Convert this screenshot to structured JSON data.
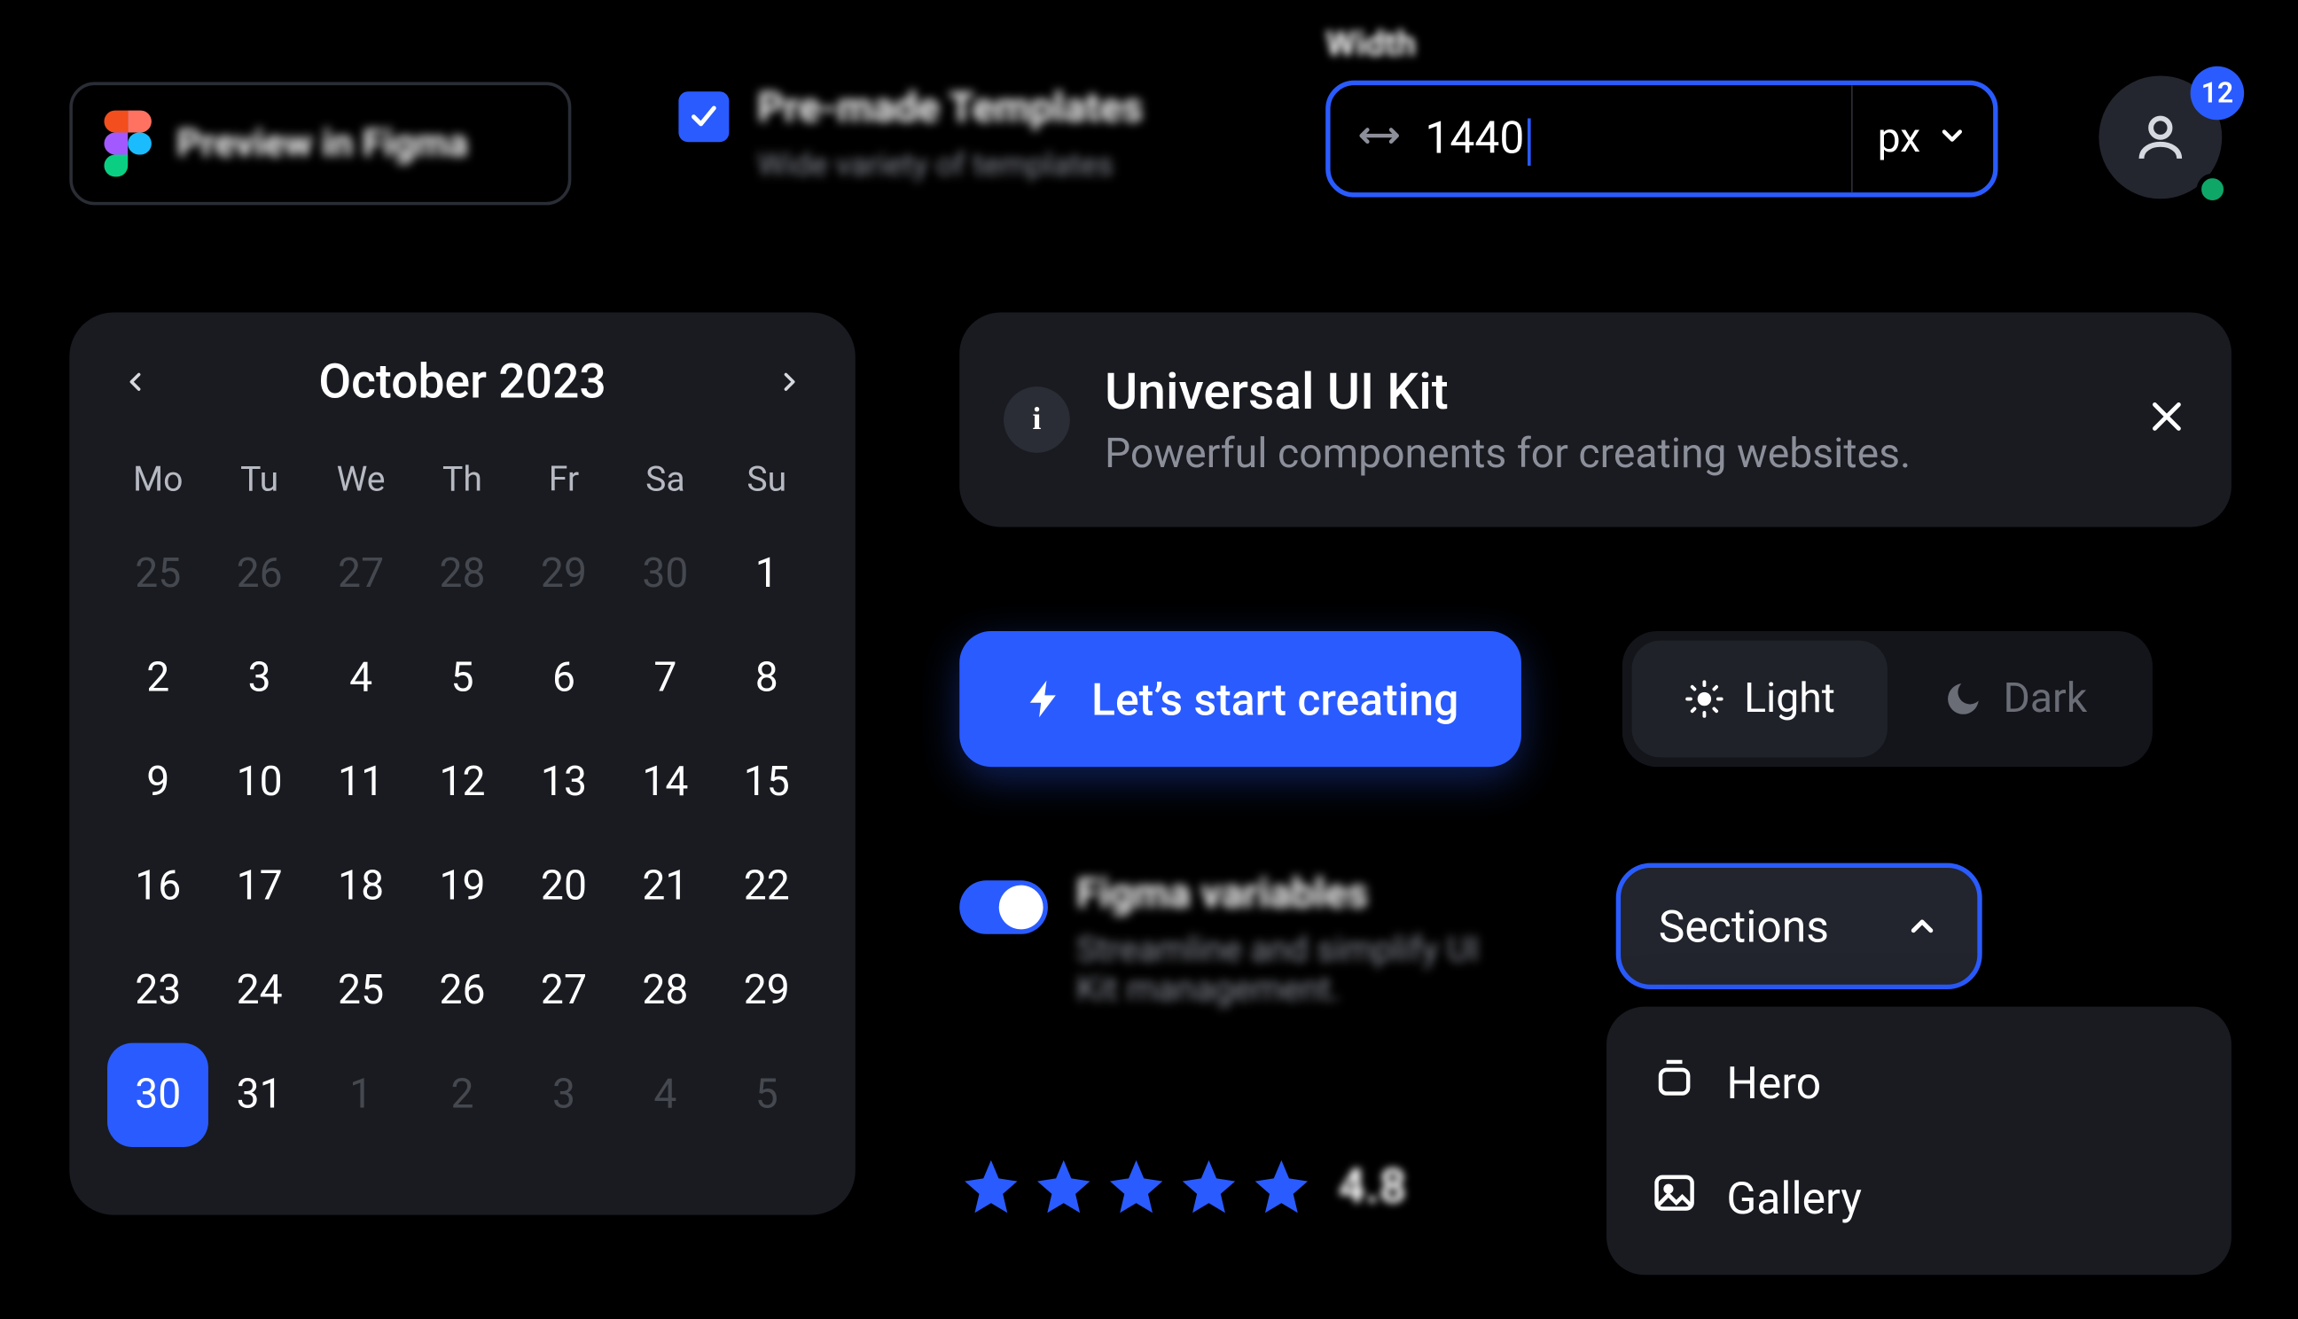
{
  "figma_button": {
    "label": "Preview in Figma"
  },
  "checkbox_feature": {
    "title": "Pre-made Templates",
    "subtitle": "Wide variety of templates"
  },
  "width_field": {
    "label": "Width",
    "value": "1440",
    "unit": "px"
  },
  "avatar": {
    "badge": "12"
  },
  "calendar": {
    "title": "October 2023",
    "weekdays": [
      "Mo",
      "Tu",
      "We",
      "Th",
      "Fr",
      "Sa",
      "Su"
    ],
    "days": [
      {
        "n": "25",
        "other": true
      },
      {
        "n": "26",
        "other": true
      },
      {
        "n": "27",
        "other": true
      },
      {
        "n": "28",
        "other": true
      },
      {
        "n": "29",
        "other": true
      },
      {
        "n": "30",
        "other": true
      },
      {
        "n": "1"
      },
      {
        "n": "2"
      },
      {
        "n": "3"
      },
      {
        "n": "4"
      },
      {
        "n": "5"
      },
      {
        "n": "6"
      },
      {
        "n": "7"
      },
      {
        "n": "8"
      },
      {
        "n": "9"
      },
      {
        "n": "10"
      },
      {
        "n": "11"
      },
      {
        "n": "12"
      },
      {
        "n": "13"
      },
      {
        "n": "14"
      },
      {
        "n": "15"
      },
      {
        "n": "16"
      },
      {
        "n": "17"
      },
      {
        "n": "18"
      },
      {
        "n": "19"
      },
      {
        "n": "20"
      },
      {
        "n": "21"
      },
      {
        "n": "22"
      },
      {
        "n": "23"
      },
      {
        "n": "24"
      },
      {
        "n": "25"
      },
      {
        "n": "26"
      },
      {
        "n": "27"
      },
      {
        "n": "28"
      },
      {
        "n": "29"
      },
      {
        "n": "30",
        "selected": true
      },
      {
        "n": "31"
      },
      {
        "n": "1",
        "other": true
      },
      {
        "n": "2",
        "other": true
      },
      {
        "n": "3",
        "other": true
      },
      {
        "n": "4",
        "other": true
      },
      {
        "n": "5",
        "other": true
      }
    ]
  },
  "info_banner": {
    "title": "Universal UI Kit",
    "subtitle": "Powerful components for creating websites."
  },
  "cta": {
    "label": "Let’s start creating"
  },
  "theme": {
    "light": "Light",
    "dark": "Dark"
  },
  "feature_toggle": {
    "title": "Figma variables",
    "subtitle": "Streamline and simplify UI Kit management."
  },
  "rating": {
    "value": "4.8"
  },
  "sections": {
    "button": "Sections",
    "items": [
      {
        "label": "Hero",
        "icon": "hero"
      },
      {
        "label": "Gallery",
        "icon": "gallery"
      }
    ]
  }
}
